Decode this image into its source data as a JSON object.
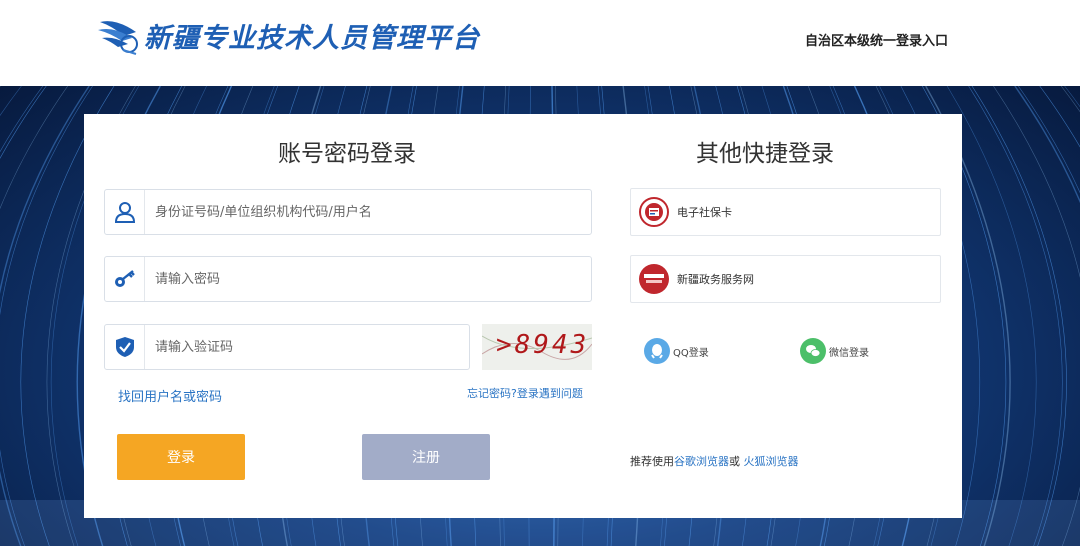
{
  "header": {
    "title": "新疆专业技术人员管理平台",
    "entry": "自治区本级统一登录入口"
  },
  "login": {
    "title": "账号密码登录",
    "user_placeholder": "身份证号码/单位组织机构代码/用户名",
    "password_placeholder": "请输入密码",
    "captcha_placeholder": "请输入验证码",
    "captcha_text": ">8943",
    "find_link": "找回用户名或密码",
    "forgot_link": "忘记密码?登录遇到问题",
    "login_button": "登录",
    "register_button": "注册"
  },
  "quick": {
    "title": "其他快捷登录",
    "items": [
      {
        "label": "电子社保卡",
        "icon": "social-security-card-icon"
      },
      {
        "label": "新疆政务服务网",
        "icon": "xinjiang-gov-service-icon"
      }
    ],
    "social": [
      {
        "label": "QQ登录",
        "icon": "qq-icon",
        "color": "#5aa9e6"
      },
      {
        "label": "微信登录",
        "icon": "wechat-icon",
        "color": "#4cbf69"
      }
    ],
    "recommend": {
      "prefix": "推荐使用",
      "chrome": "谷歌浏览器",
      "or": "或",
      "firefox": " 火狐浏览器"
    }
  },
  "colors": {
    "brand": "#1e5fb4",
    "login_button": "#f5a623",
    "register_button": "#a2acc8",
    "link": "#2a74c4"
  }
}
